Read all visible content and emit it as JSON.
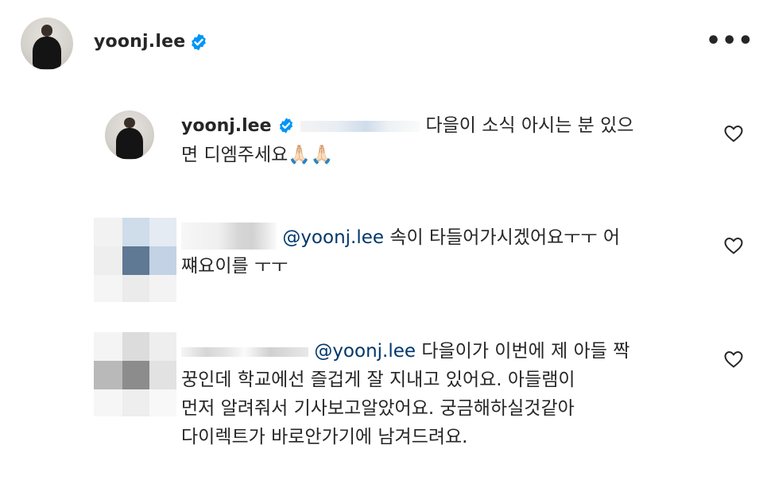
{
  "post_header": {
    "username": "yoonj.lee",
    "avatar_icon": "profile-photo",
    "verified_icon": "verified-badge-icon",
    "more_icon": "more-options-icon",
    "more_label": "•••"
  },
  "comments": [
    {
      "username": "yoonj.lee",
      "line1": "다을이 소식 아시는 분 있으",
      "line2": "면 디엠주세요",
      "emoji": "🙏🏻🙏🏻",
      "like_icon": "heart-icon"
    },
    {
      "mention": "@yoonj.lee",
      "line1": "속이 타들어가시겠어요ㅜㅜ 어",
      "line2": "쨰요이를 ㅜㅜ",
      "like_icon": "heart-icon"
    },
    {
      "mention": "@yoonj.lee",
      "line1": "다을이가 이번에 제 아들 짝",
      "line2": "꿍인데 학교에선 즐겁게 잘 지내고 있어요. 아들램이",
      "line3": "먼저 알려줘서 기사보고알았어요. 궁금해하실것같아",
      "line4": "다이렉트가 바로안가기에 남겨드려요.",
      "like_icon": "heart-icon"
    }
  ],
  "colors": {
    "text": "#262626",
    "mention": "#00376b",
    "verified": "#0095f6",
    "background": "#ffffff"
  }
}
